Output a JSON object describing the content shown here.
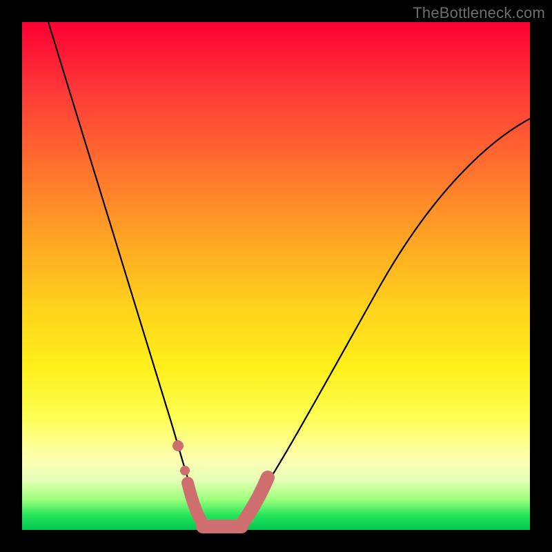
{
  "watermark": "TheBottleneck.com",
  "chart_data": {
    "type": "line",
    "title": "",
    "xlabel": "",
    "ylabel": "",
    "xlim": [
      0,
      100
    ],
    "ylim": [
      0,
      100
    ],
    "grid": false,
    "legend": false,
    "curve_color": "#000000",
    "marker_color": "#cc6666",
    "background_gradient_stops": [
      {
        "pos": 0,
        "color": "#ff0033"
      },
      {
        "pos": 28,
        "color": "#ff6e2f"
      },
      {
        "pos": 56,
        "color": "#ffd21c"
      },
      {
        "pos": 78,
        "color": "#feff55"
      },
      {
        "pos": 90,
        "color": "#e8ffb8"
      },
      {
        "pos": 100,
        "color": "#00c853"
      }
    ],
    "series": [
      {
        "name": "bottleneck-curve",
        "x": [
          5,
          10,
          15,
          20,
          25,
          28,
          30,
          32,
          34,
          36,
          38,
          40,
          45,
          50,
          55,
          60,
          65,
          70,
          75,
          80,
          85,
          90,
          95,
          100
        ],
        "y": [
          100,
          80,
          62,
          46,
          30,
          20,
          12,
          6,
          2,
          0,
          0,
          2,
          8,
          18,
          28,
          36,
          44,
          50,
          56,
          60,
          64,
          67,
          70,
          72
        ]
      }
    ],
    "markers": {
      "name": "highlight-segment",
      "x": [
        30,
        32,
        33,
        34,
        35,
        36,
        37,
        38,
        39,
        40,
        41
      ],
      "y": [
        12,
        5,
        2,
        1,
        0,
        0,
        0,
        1,
        2,
        3,
        5
      ]
    }
  }
}
